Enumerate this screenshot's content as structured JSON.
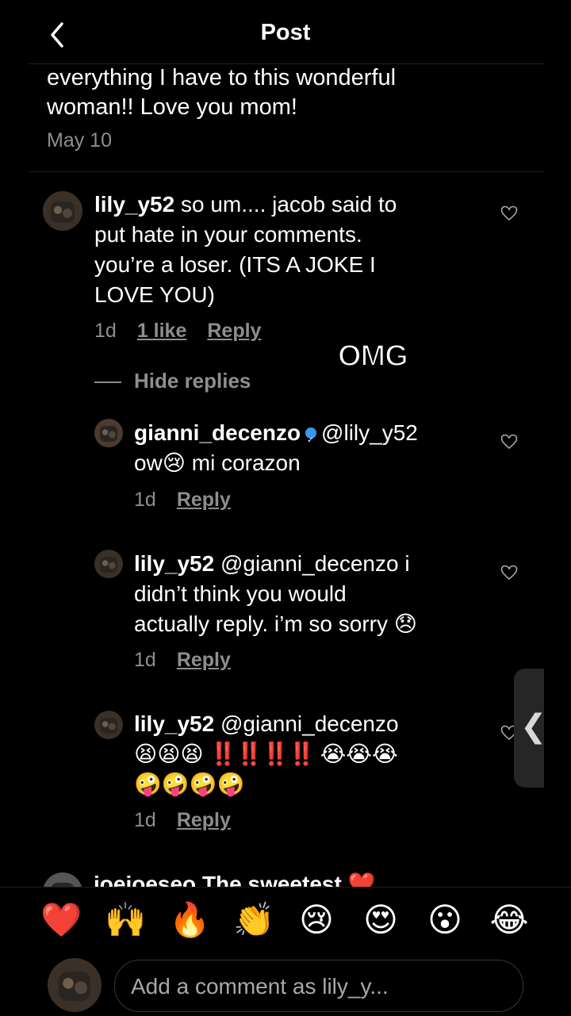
{
  "header": {
    "title": "Post"
  },
  "caption": {
    "line1": "everything I have to this wonderful",
    "line2": "woman!! Love you mom!",
    "date": "May 10"
  },
  "comment": {
    "username": "lily_y52",
    "text_l1": "so um.... jacob said to",
    "text_l2": "put hate in your comments.",
    "text_l3": "you’re a loser. (ITS A JOKE I",
    "text_l4": "LOVE YOU)",
    "time": "1d",
    "likes": "1 like",
    "reply": "Reply",
    "hide_replies": "Hide replies"
  },
  "overlay_text": "OMG",
  "replies": [
    {
      "username": "gianni_decenzo",
      "mention": "@lily_y52",
      "l1": "ow😢 mi corazon",
      "time": "1d",
      "reply": "Reply"
    },
    {
      "username": "lily_y52",
      "mention": "@gianni_decenzo i",
      "l1": "didn’t think you would",
      "l2": "actually reply. i’m so sorry 😞",
      "time": "1d",
      "reply": "Reply"
    },
    {
      "username": "lily_y52",
      "mention": "@gianni_decenzo",
      "l1a": "😫😫😫",
      "l1b": "‼️‼️‼️‼️",
      "l1c": "😭😭😭",
      "l2": "🤪🤪🤪🤪",
      "time": "1d",
      "reply": "Reply"
    }
  ],
  "partial_comment": {
    "text": "ioeioeseo The sweetest ❤️"
  },
  "reactions": [
    "❤️",
    "🙌",
    "🔥",
    "👏",
    "😢",
    "😍",
    "😮",
    "😂"
  ],
  "comment_input": {
    "placeholder": "Add a comment as lily_y..."
  },
  "colors": {
    "background": "#000000",
    "secondary_text": "#8e8e8e",
    "verified": "#3897f0"
  }
}
